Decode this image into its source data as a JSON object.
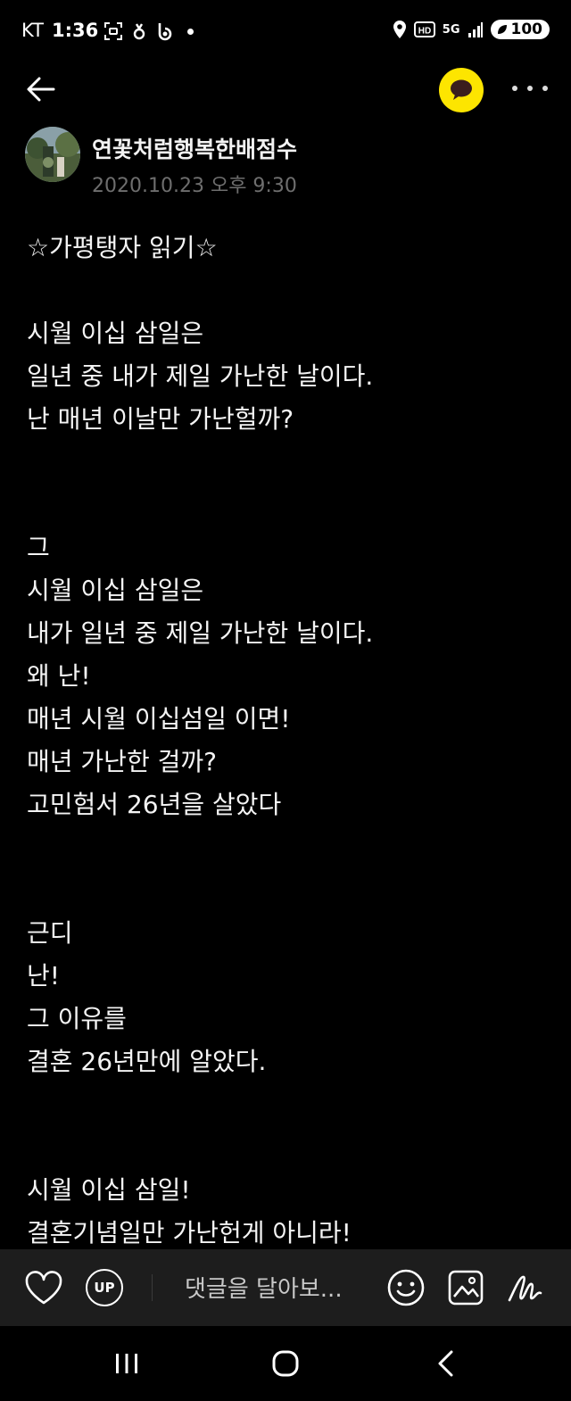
{
  "status_bar": {
    "carrier": "KT",
    "time": "1:36",
    "battery": "100",
    "network": "5G"
  },
  "header": {
    "back_icon": "arrow-left-icon",
    "chat_icon": "kakaotalk-chat-icon",
    "more_icon": "more-horizontal-icon",
    "accent_color": "#FDE500"
  },
  "author": {
    "name": "연꽃처럼행복한배점수",
    "date": "2020.10.23 오후 9:30"
  },
  "post": {
    "lines": [
      "☆가평탱자 읽기☆",
      "",
      "시월 이십 삼일은",
      "일년 중 내가 제일 가난한 날이다.",
      "난 매년 이날만 가난헐까?",
      "",
      "",
      "그",
      "시월 이십 삼일은",
      "내가 일년 중 제일 가난한 날이다.",
      "왜 난!",
      "매년 시월 이십섬일 이면!",
      "매년 가난한 걸까?",
      "고민험서 26년을 살았다",
      "",
      "",
      "근디",
      "난!",
      "그 이유를",
      "결혼 26년만에 알았다.",
      "",
      "",
      "시월 이십 삼일!",
      "결혼기념일만 가난헌게 아니라!"
    ]
  },
  "comment_bar": {
    "like_icon": "heart-icon",
    "up_label": "UP",
    "placeholder": "댓글을 달아보...",
    "emoji_icon": "smiley-icon",
    "image_icon": "image-icon",
    "draw_icon": "handwriting-icon"
  },
  "nav_bar": {
    "recent_icon": "recent-apps-icon",
    "home_icon": "home-icon",
    "back_icon": "nav-back-icon"
  }
}
